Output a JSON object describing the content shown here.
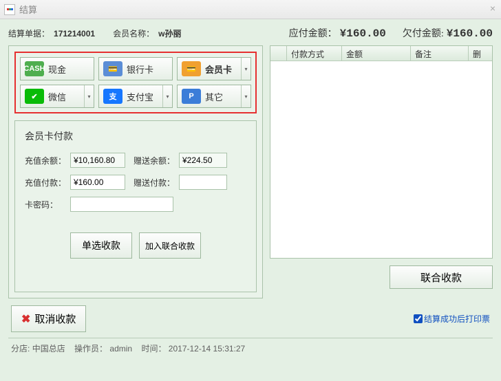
{
  "window": {
    "title": "结算",
    "close": "×"
  },
  "header": {
    "order_label": "结算单据：",
    "order_value": "171214001",
    "member_label": "会员名称：",
    "member_value": "w孙丽",
    "due_label": "应付金额：",
    "due_value": "¥160.00",
    "owed_label": "欠付金额:",
    "owed_value": "¥160.00"
  },
  "pay_methods": {
    "cash": "现金",
    "bank": "银行卡",
    "member": "会员卡",
    "wechat": "微信",
    "alipay": "支付宝",
    "other": "其它"
  },
  "member_form": {
    "title": "会员卡付款",
    "recharge_balance_label": "充值余额：",
    "recharge_balance_value": "¥10,160.80",
    "bonus_balance_label": "赠送余额：",
    "bonus_balance_value": "¥224.50",
    "recharge_pay_label": "充值付款：",
    "recharge_pay_value": "¥160.00",
    "bonus_pay_label": "赠送付款：",
    "bonus_pay_value": "",
    "card_pwd_label": "卡密码：",
    "card_pwd_value": ""
  },
  "actions": {
    "single_collect": "单选收款",
    "add_combined": "加入联合收款",
    "combined_collect": "联合收款",
    "cancel_collect": "取消收款",
    "print_after": "结算成功后打印票"
  },
  "table": {
    "col_blank": "",
    "col_method": "付款方式",
    "col_amount": "金额",
    "col_remark": "备注",
    "col_delete": "删"
  },
  "status": {
    "branch_label": "分店:",
    "branch_value": "中国总店",
    "operator_label": "操作员：",
    "operator_value": "admin",
    "time_label": "时间：",
    "time_value": "2017-12-14 15:31:27"
  }
}
